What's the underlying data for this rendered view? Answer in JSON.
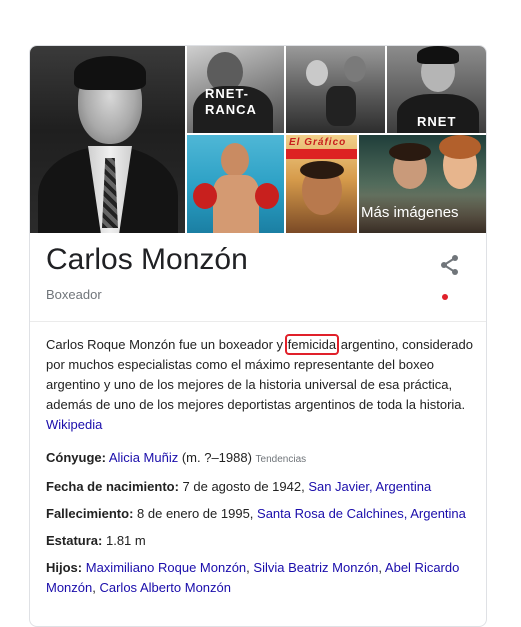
{
  "gallery": {
    "more_images_label": "Más imágenes",
    "photo_text_a": "RNET-\nRANCA",
    "photo_text_c": "RNET",
    "photo_text_e": "El Gráfico"
  },
  "header": {
    "name": "Carlos Monzón",
    "subtitle": "Boxeador",
    "share_icon": "share-icon"
  },
  "description": {
    "part1": "Carlos Roque Monzón fue un boxeador y ",
    "highlighted": "femicida",
    "part2": " argentino, considerado por muchos especialistas como el máximo representante del boxeo argentino y uno de los mejores de la historia universal de esa práctica, además de uno de los mejores deportistas argentinos de toda la historia. ",
    "source": "Wikipedia"
  },
  "facts": {
    "spouse": {
      "label": "Cónyuge:",
      "link": "Alicia Muñiz",
      "extra": " (m. ?–1988) ",
      "trend": "Tendencias"
    },
    "birth": {
      "label": "Fecha de nacimiento:",
      "value": " 7 de agosto de 1942, ",
      "place": "San Javier, Argentina"
    },
    "death": {
      "label": "Fallecimiento:",
      "value": " 8 de enero de 1995, ",
      "place": "Santa Rosa de Calchines, Argentina"
    },
    "height": {
      "label": "Estatura:",
      "value": " 1.81 m"
    },
    "children": {
      "label": "Hijos:",
      "c1": "Maximiliano Roque Monzón",
      "sep1": ", ",
      "c2": "Silvia Beatriz Monzón",
      "sep2": ", ",
      "c3": "Abel Ricardo Monzón",
      "sep3": ", ",
      "c4": "Carlos Alberto Monzón"
    }
  },
  "colors": {
    "link": "#1a0dab",
    "annotation": "#e0202a",
    "muted": "#70757a"
  }
}
